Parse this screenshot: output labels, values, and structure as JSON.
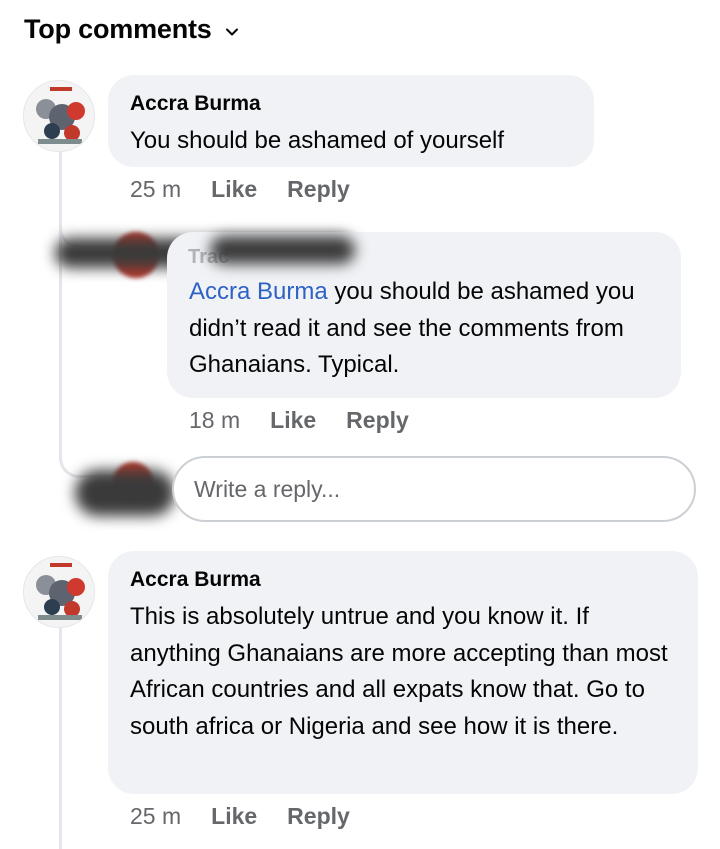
{
  "header": {
    "title": "Top comments",
    "chevron_icon": "chevron-down-icon"
  },
  "comments": [
    {
      "author": "Accra Burma",
      "text": "You should be ashamed of yourself",
      "time": "25 m",
      "like_label": "Like",
      "reply_label": "Reply"
    },
    {
      "author": "Accra Burma",
      "text": "This is absolutely untrue and you know it. If anything Ghanaians are more accepting than most African countries and all expats know that. Go to south africa or Nigeria and see how it is there.",
      "time": "25 m",
      "like_label": "Like",
      "reply_label": "Reply"
    }
  ],
  "reply": {
    "author_redacted": "Trac",
    "mention": "Accra Burma",
    "text": " you should be ashamed you didn’t read it and see the comments from Ghanaians. Typical.",
    "time": "18 m",
    "like_label": "Like",
    "reply_label": "Reply"
  },
  "reply_input": {
    "placeholder": "Write a reply..."
  },
  "colors": {
    "bubble": "#f0f2f5",
    "mention": "#2e62c5",
    "meta": "#65676b",
    "thread_line": "#e4e6eb"
  }
}
